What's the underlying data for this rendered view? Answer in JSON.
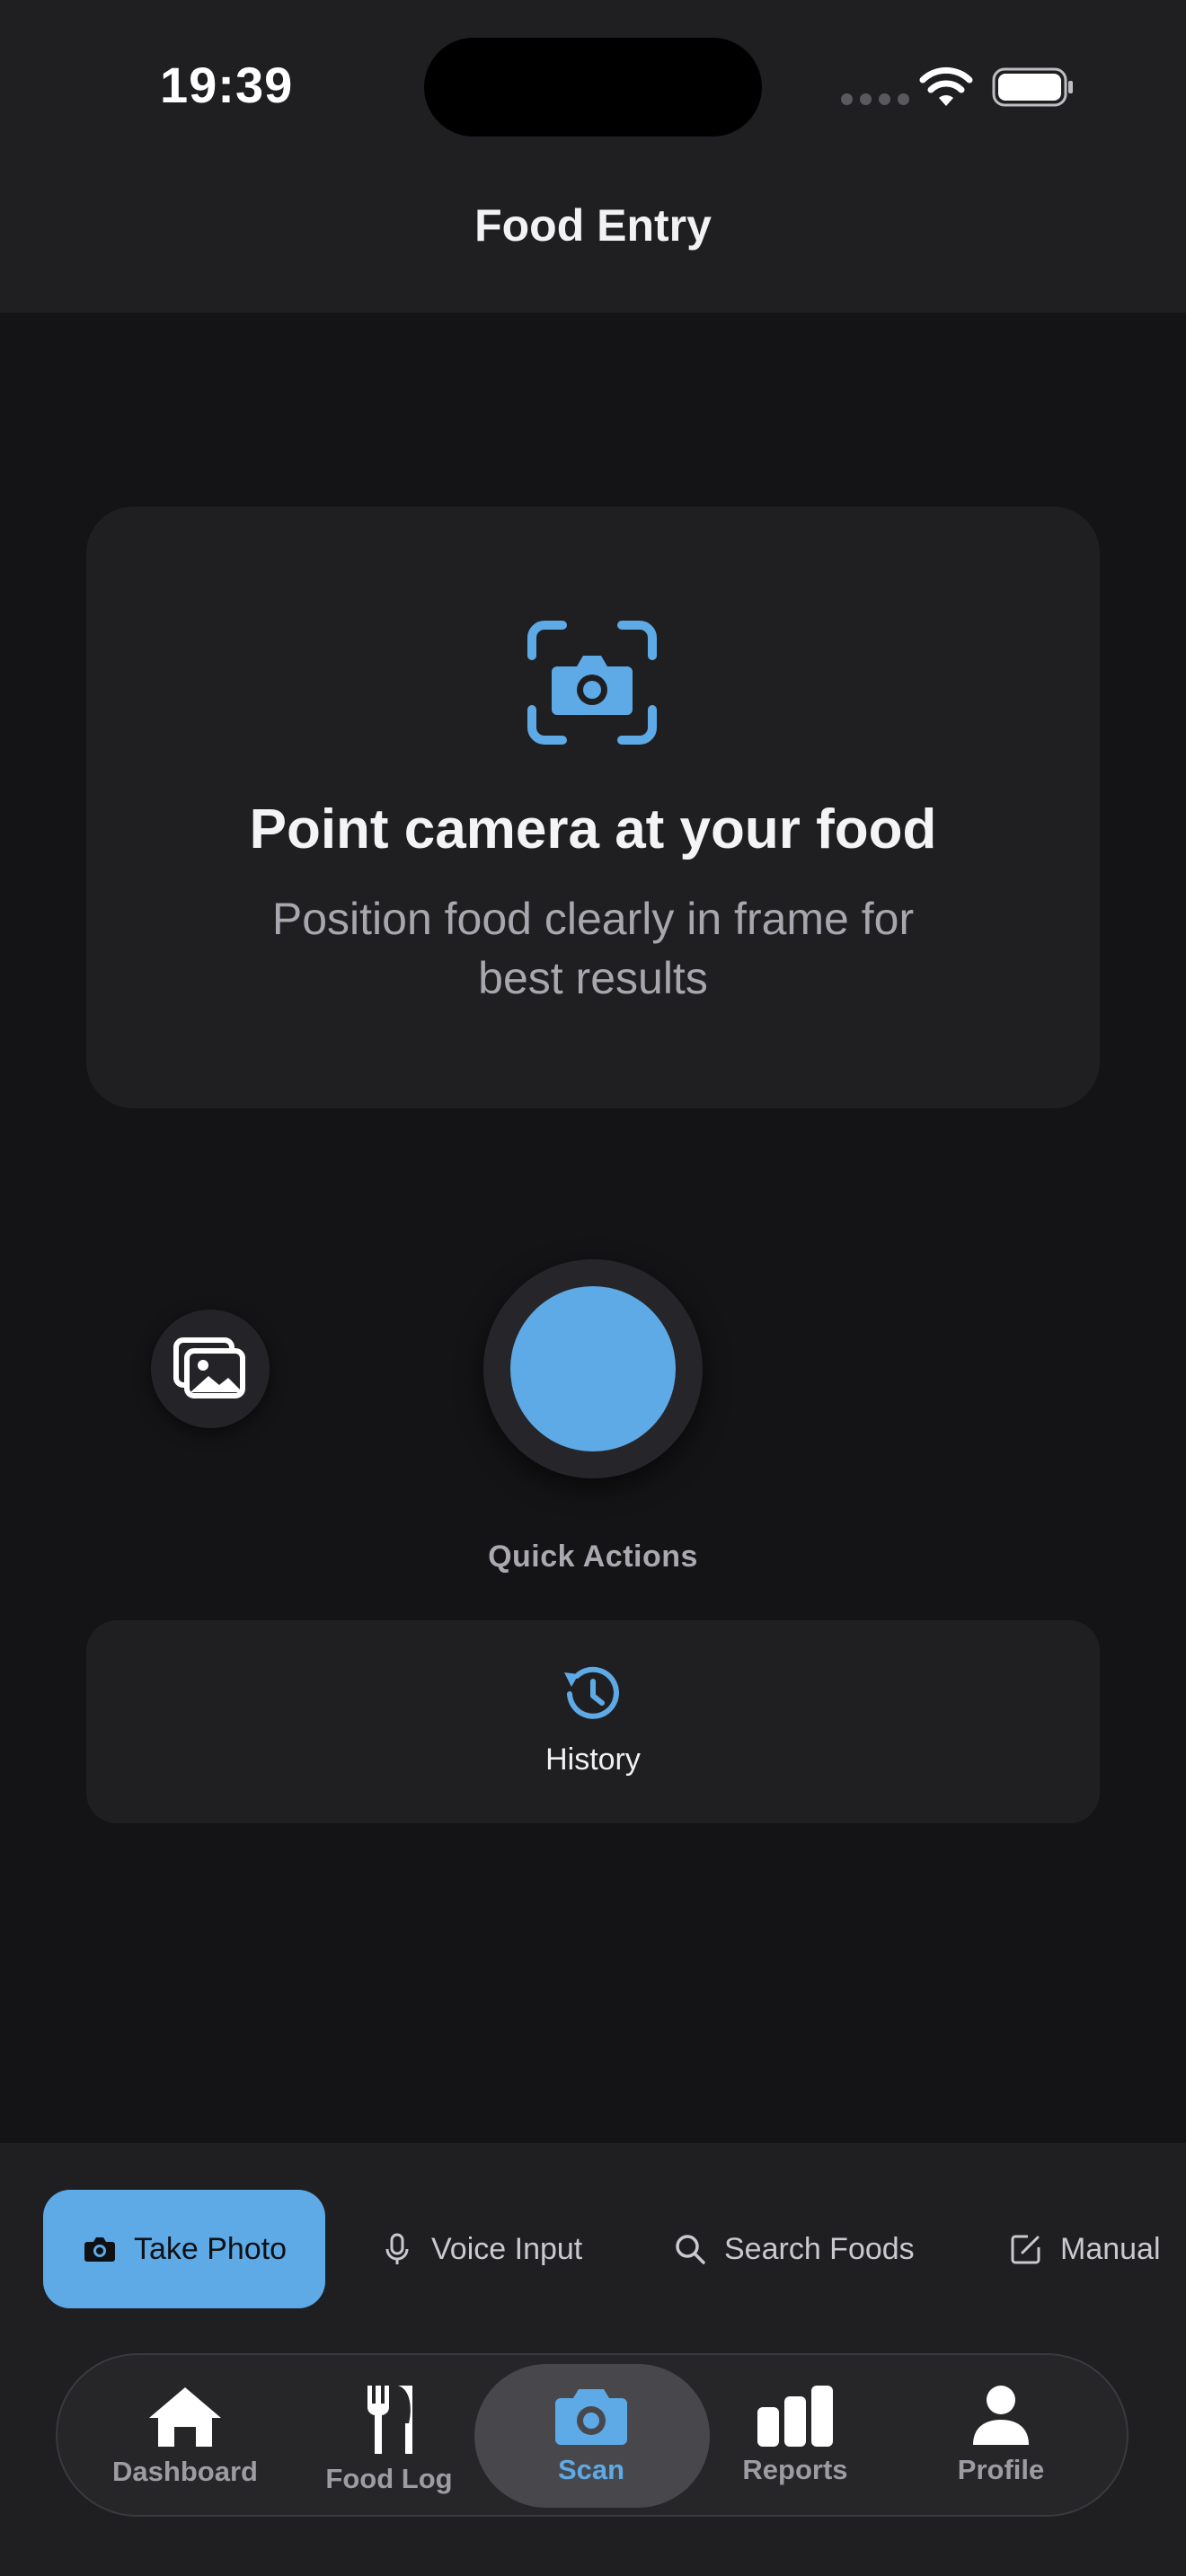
{
  "status_bar": {
    "time": "19:39"
  },
  "header": {
    "title": "Food Entry"
  },
  "hint": {
    "icon": "camera-viewfinder-icon",
    "title": "Point camera at your food",
    "subtitle": "Position food clearly in frame for best results"
  },
  "capture": {
    "gallery_icon": "photo-gallery-icon",
    "shutter_icon": "shutter-button"
  },
  "quick_actions": {
    "label": "Quick Actions",
    "items": [
      {
        "label": "History",
        "icon": "history-icon"
      }
    ]
  },
  "input_modes": [
    {
      "label": "Take Photo",
      "icon": "camera-icon",
      "active": true
    },
    {
      "label": "Voice Input",
      "icon": "microphone-icon",
      "active": false
    },
    {
      "label": "Search Foods",
      "icon": "search-icon",
      "active": false
    },
    {
      "label": "Manual",
      "icon": "edit-icon",
      "active": false
    }
  ],
  "tabs": [
    {
      "label": "Dashboard",
      "icon": "house-icon",
      "active": false
    },
    {
      "label": "Food Log",
      "icon": "fork-knife-icon",
      "active": false
    },
    {
      "label": "Scan",
      "icon": "camera-icon",
      "active": true
    },
    {
      "label": "Reports",
      "icon": "bar-chart-icon",
      "active": false
    },
    {
      "label": "Profile",
      "icon": "person-icon",
      "active": false
    }
  ],
  "colors": {
    "accent": "#5eaae6",
    "background": "#141416",
    "surface": "#1f1f22"
  }
}
